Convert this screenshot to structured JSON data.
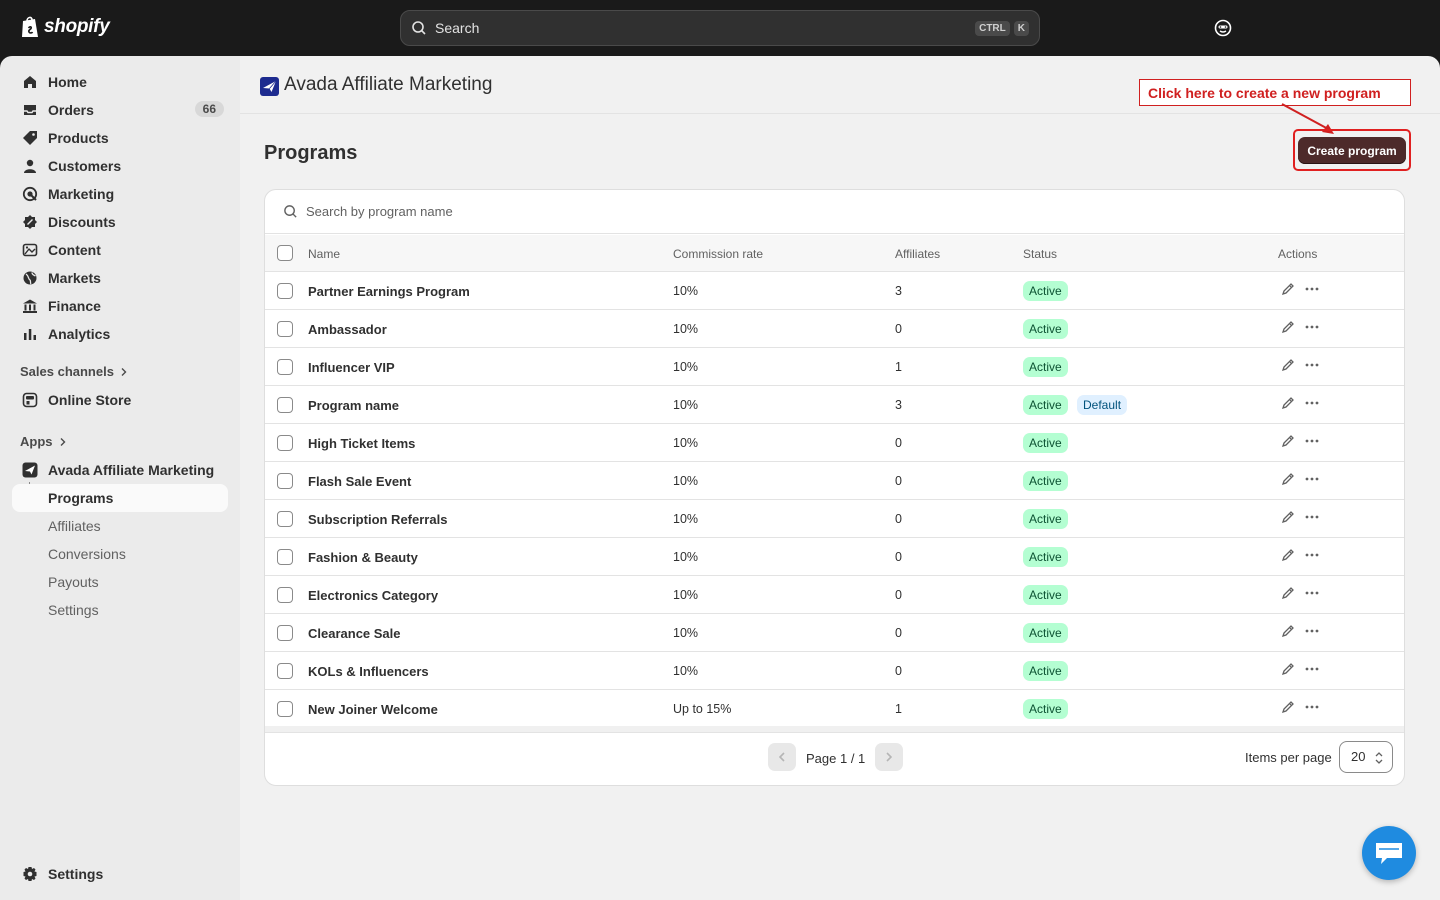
{
  "topbar": {
    "brand": "shopify",
    "search_placeholder": "Search",
    "shortcut_keys": [
      "CTRL",
      "K"
    ],
    "icons": [
      "search-icon",
      "store-avatar-icon"
    ]
  },
  "sidebar": {
    "nav": [
      {
        "label": "Home",
        "icon": "home-icon"
      },
      {
        "label": "Orders",
        "icon": "inbox-icon",
        "count": "66"
      },
      {
        "label": "Products",
        "icon": "tag-icon"
      },
      {
        "label": "Customers",
        "icon": "person-icon"
      },
      {
        "label": "Marketing",
        "icon": "target-icon"
      },
      {
        "label": "Discounts",
        "icon": "discount-icon"
      },
      {
        "label": "Content",
        "icon": "image-icon"
      },
      {
        "label": "Markets",
        "icon": "globe-icon"
      },
      {
        "label": "Finance",
        "icon": "bank-icon"
      },
      {
        "label": "Analytics",
        "icon": "bar-chart-icon"
      }
    ],
    "sales_channels_title": "Sales channels",
    "online_store": "Online Store",
    "apps_title": "Apps",
    "app_name": "Avada Affiliate Marketing",
    "app_subnav": [
      {
        "label": "Programs",
        "active": true
      },
      {
        "label": "Affiliates"
      },
      {
        "label": "Conversions"
      },
      {
        "label": "Payouts"
      },
      {
        "label": "Settings"
      }
    ],
    "settings": "Settings"
  },
  "main": {
    "app_title": "Avada Affiliate Marketing",
    "annotation": "Click here to create a new program",
    "page_title": "Programs",
    "create_button": "Create program",
    "search_placeholder": "Search by program name",
    "columns": [
      "Name",
      "Commission rate",
      "Affiliates",
      "Status",
      "Actions"
    ],
    "rows": [
      {
        "name": "Partner Earnings Program",
        "rate": "10%",
        "affiliates": "3",
        "status": "Active"
      },
      {
        "name": "Ambassador",
        "rate": "10%",
        "affiliates": "0",
        "status": "Active"
      },
      {
        "name": "Influencer VIP",
        "rate": "10%",
        "affiliates": "1",
        "status": "Active"
      },
      {
        "name": "Program name",
        "rate": "10%",
        "affiliates": "3",
        "status": "Active",
        "tag": "Default"
      },
      {
        "name": "High Ticket Items",
        "rate": "10%",
        "affiliates": "0",
        "status": "Active"
      },
      {
        "name": "Flash Sale Event",
        "rate": "10%",
        "affiliates": "0",
        "status": "Active"
      },
      {
        "name": "Subscription Referrals",
        "rate": "10%",
        "affiliates": "0",
        "status": "Active"
      },
      {
        "name": "Fashion & Beauty",
        "rate": "10%",
        "affiliates": "0",
        "status": "Active"
      },
      {
        "name": "Electronics Category",
        "rate": "10%",
        "affiliates": "0",
        "status": "Active"
      },
      {
        "name": "Clearance Sale",
        "rate": "10%",
        "affiliates": "0",
        "status": "Active"
      },
      {
        "name": "KOLs & Influencers",
        "rate": "10%",
        "affiliates": "0",
        "status": "Active"
      },
      {
        "name": "New Joiner Welcome",
        "rate": "Up to 15%",
        "affiliates": "1",
        "status": "Active"
      }
    ],
    "pagination": {
      "text": "Page 1 / 1"
    },
    "items_per_page_label": "Items per page",
    "items_per_page_value": "20"
  },
  "colors": {
    "topbar": "#1a1a1a",
    "create_button": "#4d2a2a",
    "annotation_red": "#d02020",
    "active_badge": "#b4fed2",
    "default_badge": "#e0f0ff",
    "chat_button": "#1f8be0"
  }
}
